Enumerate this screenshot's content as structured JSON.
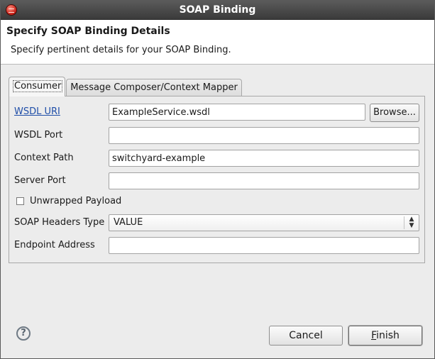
{
  "window": {
    "title": "SOAP Binding",
    "icon": "eclipse-app-icon"
  },
  "header": {
    "title": "Specify SOAP Binding Details",
    "description": "Specify pertinent details for your SOAP Binding."
  },
  "tabs": [
    {
      "label": "Consumer",
      "selected": true
    },
    {
      "label": "Message Composer/Context Mapper",
      "selected": false
    }
  ],
  "form": {
    "wsdl_uri": {
      "label": "WSDL URI",
      "value": "ExampleService.wsdl"
    },
    "browse_label": "Browse...",
    "wsdl_port": {
      "label": "WSDL Port",
      "value": ""
    },
    "context_path": {
      "label": "Context Path",
      "value": "switchyard-example"
    },
    "server_port": {
      "label": "Server Port",
      "value": ""
    },
    "unwrapped_payload": {
      "label": "Unwrapped Payload",
      "checked": false
    },
    "soap_headers_type": {
      "label": "SOAP Headers Type",
      "value": "VALUE"
    },
    "endpoint_address": {
      "label": "Endpoint Address",
      "value": ""
    }
  },
  "footer": {
    "help_icon": "question-mark-icon",
    "cancel_label": "Cancel",
    "finish_first": "F",
    "finish_rest": "inish"
  }
}
